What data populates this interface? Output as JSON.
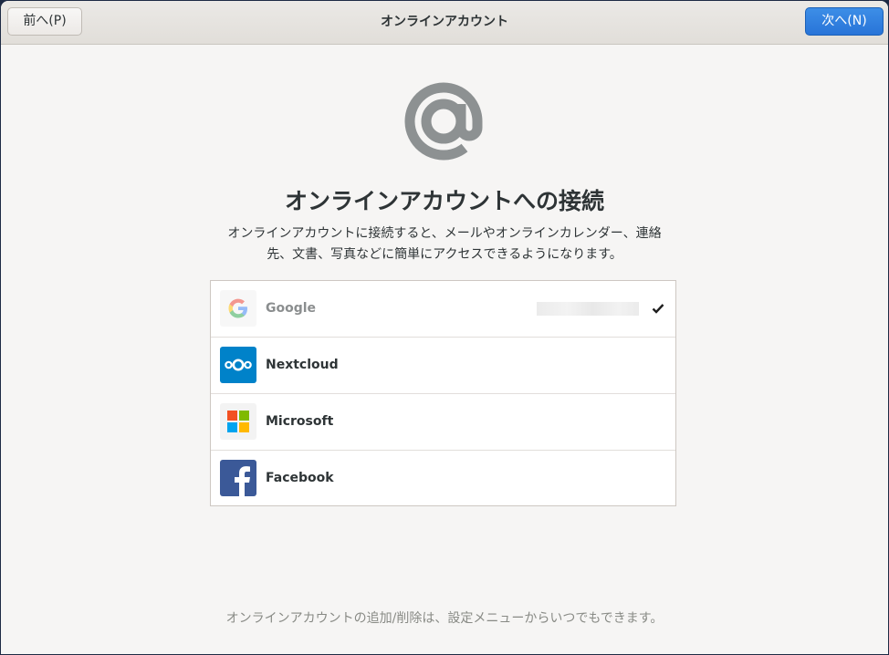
{
  "header": {
    "back_label": "前へ(P)",
    "title": "オンラインアカウント",
    "next_label": "次へ(N)"
  },
  "main": {
    "icon": "at-sign-icon",
    "title": "オンラインアカウントへの接続",
    "description_line1": "オンラインアカウントに接続すると、メールやオンラインカレンダー、連絡",
    "description_line2": "先、文書、写真などに簡単にアクセスできるようになります。"
  },
  "providers": [
    {
      "label": "Google",
      "icon": "google-icon",
      "connected": true
    },
    {
      "label": "Nextcloud",
      "icon": "nextcloud-icon",
      "connected": false
    },
    {
      "label": "Microsoft",
      "icon": "microsoft-icon",
      "connected": false
    },
    {
      "label": "Facebook",
      "icon": "facebook-icon",
      "connected": false
    }
  ],
  "footer": {
    "note": "オンラインアカウントの追加/削除は、設定メニューからいつでもできます。"
  },
  "colors": {
    "accent": "#2a7ad8",
    "background": "#f6f5f4",
    "icon_gray": "#8d9192",
    "nextcloud": "#0082c9",
    "facebook": "#3b5998"
  }
}
